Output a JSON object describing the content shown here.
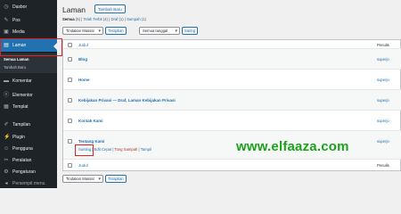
{
  "sidebar": {
    "items": [
      {
        "label": "Dasbor",
        "icon": "dashboard-icon",
        "glyph": "◷"
      },
      {
        "label": "Pos",
        "icon": "pin-icon",
        "glyph": "✎"
      },
      {
        "label": "Media",
        "icon": "media-icon",
        "glyph": "▣"
      },
      {
        "label": "Laman",
        "icon": "pages-icon",
        "glyph": "▤"
      },
      {
        "label": "Komentar",
        "icon": "comments-icon",
        "glyph": "▬"
      },
      {
        "label": "Elementor",
        "icon": "elementor-icon",
        "glyph": "ⓔ"
      },
      {
        "label": "Templat",
        "icon": "templates-icon",
        "glyph": "▦"
      },
      {
        "label": "Tampilan",
        "icon": "appearance-icon",
        "glyph": "✐"
      },
      {
        "label": "Plugin",
        "icon": "plugins-icon",
        "glyph": "⚡"
      },
      {
        "label": "Pengguna",
        "icon": "users-icon",
        "glyph": "☺"
      },
      {
        "label": "Peralatan",
        "icon": "tools-icon",
        "glyph": "✂"
      },
      {
        "label": "Pengaturan",
        "icon": "settings-icon",
        "glyph": "⚙"
      },
      {
        "label": "Persempit menu",
        "icon": "collapse-icon",
        "glyph": "◂"
      }
    ],
    "submenu": [
      "Semua Laman",
      "Tambah Baru"
    ]
  },
  "header": {
    "title": "Laman",
    "add_new": "Tambah Baru"
  },
  "filters": {
    "all": "Semua",
    "all_count": "(5)",
    "published": "Telah Terbit",
    "published_count": "(4)",
    "draft": "Draf",
    "draft_count": "(1)",
    "trash": "Sampah",
    "trash_count": "(1)"
  },
  "toolbar": {
    "bulk_action": "Tindakan Massal",
    "apply": "Terapkan",
    "all_dates": "Semua tanggal",
    "filter": "Saring"
  },
  "table": {
    "col_title": "Judul",
    "col_author": "Penulis",
    "rows": [
      {
        "title": "Blog",
        "author": "superjo"
      },
      {
        "title": "Home",
        "author": "superjo"
      },
      {
        "title": "Kebijakan Privasi — Draf, Laman Kebijakan Privasi",
        "author": "superjo"
      },
      {
        "title": "Kontak Kami",
        "author": "superjo"
      },
      {
        "title": "Tentang Kami",
        "author": "superjo"
      }
    ],
    "row_actions": {
      "edit": "Sunting",
      "quick_edit": "Edit Cepat",
      "trash": "Tong Sampah",
      "view": "Tampil"
    }
  },
  "watermark": "www.elfaaza.com",
  "colors": {
    "sidebar_bg": "#1d2327",
    "accent": "#2271b1",
    "highlight_box": "#e02424",
    "watermark": "#1aa31a"
  }
}
